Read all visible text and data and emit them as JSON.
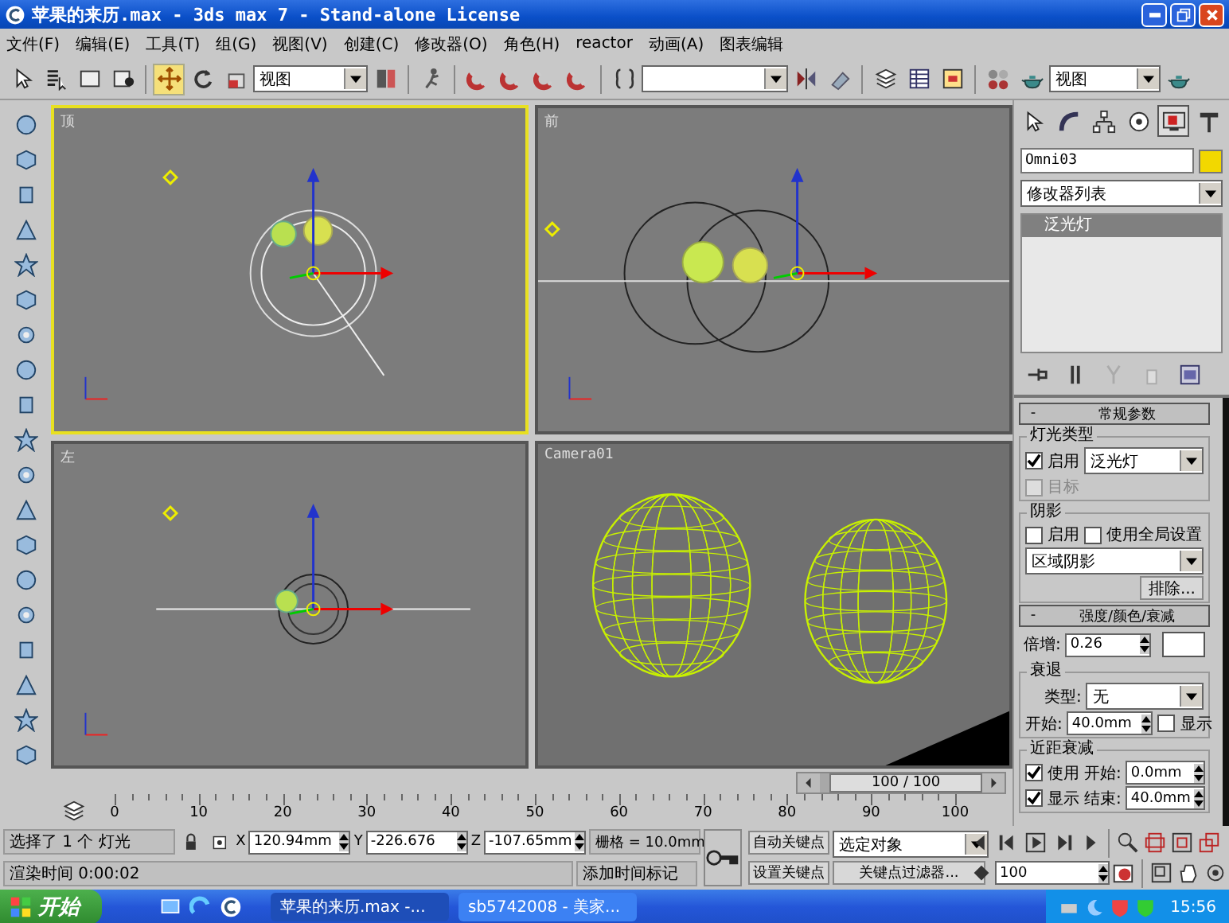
{
  "window": {
    "title": "苹果的来历.max - 3ds max 7  - Stand-alone License"
  },
  "menu": [
    "文件(F)",
    "编辑(E)",
    "工具(T)",
    "组(G)",
    "视图(V)",
    "创建(C)",
    "修改器(O)",
    "角色(H)",
    "reactor",
    "动画(A)",
    "图表编辑"
  ],
  "toolbar": {
    "coord_dropdown": "视图",
    "render_dropdown": "视图"
  },
  "viewports": [
    {
      "label": "顶",
      "kind": "top",
      "selected": true
    },
    {
      "label": "前",
      "kind": "front",
      "selected": false
    },
    {
      "label": "左",
      "kind": "left",
      "selected": false
    },
    {
      "label": "Camera01",
      "kind": "camera",
      "selected": false
    }
  ],
  "command_panel": {
    "tabs": [
      {
        "kind": "create",
        "selected": false
      },
      {
        "kind": "modify",
        "selected": false
      },
      {
        "kind": "hierarchy",
        "selected": false
      },
      {
        "kind": "motion",
        "selected": false
      },
      {
        "kind": "display",
        "selected": true
      },
      {
        "kind": "utilities",
        "selected": false
      }
    ],
    "object_name": "Omni03",
    "modifier_list": "修改器列表",
    "stack": [
      {
        "label": "泛光灯",
        "selected": true
      }
    ],
    "general": {
      "toggle": "-",
      "title": "常规参数",
      "light_type": {
        "title": "灯光类型",
        "enabled": {
          "label": "启用",
          "checked": true,
          "disabled": false
        },
        "type": "泛光灯",
        "target": {
          "label": "目标",
          "checked": false,
          "disabled": true
        }
      },
      "shadows": {
        "title": "阴影",
        "enabled": {
          "label": "启用",
          "checked": false,
          "disabled": false
        },
        "global": {
          "label": "使用全局设置",
          "checked": false,
          "disabled": false
        },
        "type": "区域阴影",
        "exclude": "排除..."
      }
    },
    "intensity": {
      "toggle": "-",
      "title": "强度/颜色/衰减",
      "multiplier_label": "倍增:",
      "multiplier": "0.26",
      "decay": {
        "title": "衰退",
        "type_label": "类型:",
        "type": "无",
        "start_label": "开始:",
        "start": "40.0mm",
        "show": {
          "label": "显示",
          "checked": false,
          "disabled": false
        }
      },
      "near": {
        "title": "近距衰减",
        "use": {
          "label": "使用",
          "checked": true,
          "disabled": false
        },
        "start_label": "开始:",
        "start": "0.0mm",
        "show": {
          "label": "显示",
          "checked": true,
          "disabled": false
        },
        "end_label": "结束:",
        "end": "40.0mm"
      }
    }
  },
  "time_slider": {
    "label": "100 / 100",
    "level": 1
  },
  "ruler": [
    "0",
    "10",
    "20",
    "30",
    "40",
    "50",
    "60",
    "70",
    "80",
    "90",
    "100"
  ],
  "status": {
    "selection": "选择了 1 个 灯光",
    "coords": [
      {
        "axis": "X",
        "value": "120.94mm"
      },
      {
        "axis": "Y",
        "value": "-226.676"
      },
      {
        "axis": "Z",
        "value": "-107.65mm"
      }
    ],
    "grid": "栅格 = 10.0mm",
    "render_time": "渲染时间   0:00:02",
    "add_tag": "添加时间标记"
  },
  "animation": {
    "auto_key": "自动关键点",
    "set_key": "设置关键点",
    "key_set": "选定对象",
    "key_filters": "关键点过滤器...",
    "frame": "100"
  },
  "taskbar": {
    "start": "开始",
    "tasks": [
      {
        "label": "苹果的来历.max -...",
        "selected": true
      },
      {
        "label": "sb5742008 - 美家...",
        "selected": false
      }
    ],
    "clock": "15:56"
  }
}
